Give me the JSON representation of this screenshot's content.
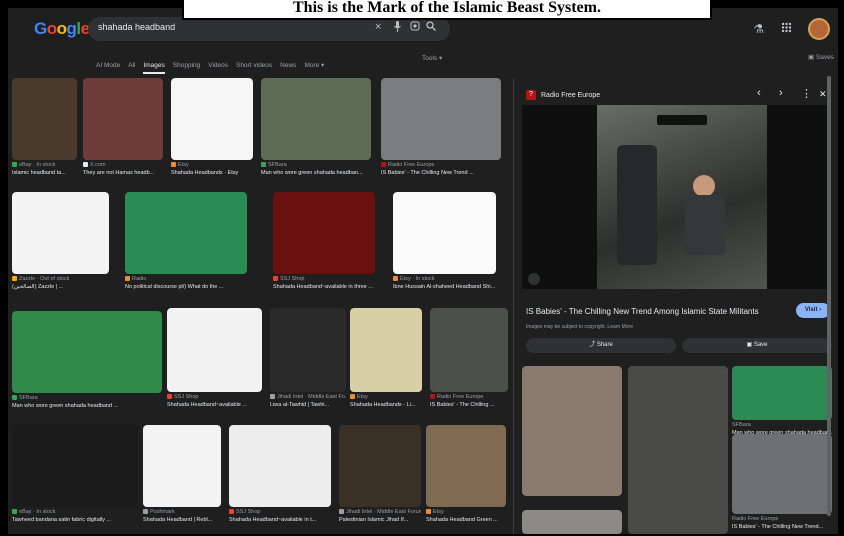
{
  "caption": "This is the Mark of the Islamic Beast System.",
  "header": {
    "logo": [
      "G",
      "o",
      "o",
      "g",
      "l",
      "e"
    ],
    "logo_colors": [
      "#4285f4",
      "#ea4335",
      "#fbbc05",
      "#4285f4",
      "#34a853",
      "#ea4335"
    ],
    "search_value": "shahada headband",
    "icons": {
      "clear": "×",
      "mic": "🎤",
      "lens": "◎",
      "search": "🔍"
    },
    "right": {
      "labs": "⚗",
      "apps": "⋮⋮⋮"
    }
  },
  "tabs": [
    "AI Mode",
    "All",
    "Images",
    "Shopping",
    "Videos",
    "Short videos",
    "News",
    "More ▾"
  ],
  "active_tab": "Images",
  "tools": "Tools ▾",
  "saves": "Saves",
  "results": [
    {
      "src": "eBay · In stock",
      "title": "Islamic headband ta...",
      "color": "#34a853",
      "bg": "#4a3a2c"
    },
    {
      "src": "X.com",
      "title": "They are not Hamas headb...",
      "color": "#e8eaed",
      "bg": "#6e3d3a"
    },
    {
      "src": "Etsy",
      "title": "Shahada Headbands · Etsy",
      "color": "#f28b30",
      "bg": "#f6f6f6"
    },
    {
      "src": "SFBara",
      "title": "Man who wore green shahada headban...",
      "color": "#34a853",
      "bg": "#5c6a56"
    },
    {
      "src": "Radio Free Europe",
      "title": "IS Babies' - The Chilling New Trend ...",
      "color": "#b31515",
      "bg": "#7a7c7e"
    },
    {
      "src": "Zazzle · Out of stock",
      "title": "(الصالحين) Zazzle | ...",
      "color": "#f9ab00",
      "bg": "#f4f4f4"
    },
    {
      "src": "Radio",
      "title": "No political discourse pl/) What do the ...",
      "color": "#f28b30",
      "bg": "#2c8a55"
    },
    {
      "src": "SSJ Shop",
      "title": "Shahada Headband~available in three ...",
      "color": "#ea4335",
      "bg": "#6a1010"
    },
    {
      "src": "Etsy · In stock",
      "title": "Ibne Hussain Al-shaheed Headband Shi...",
      "color": "#f28b30",
      "bg": "#fafafa"
    },
    {
      "src": "SFBara",
      "title": "Man who wore green shahada headband ...",
      "color": "#34a853",
      "bg": "#2f8a4a"
    },
    {
      "src": "SSJ Shop",
      "title": "Shahada Headband~available ...",
      "color": "#ea4335",
      "bg": "#f2f2f2"
    },
    {
      "src": "Jihadi Intel · Middle East Fo...",
      "title": "Liwa al-Tawhid | Tawhi...",
      "color": "#9aa0a6",
      "bg": "#2a2a2a"
    },
    {
      "src": "Etsy",
      "title": "Shahada Headbands - Li...",
      "color": "#f28b30",
      "bg": "#d7cfa5"
    },
    {
      "src": "Radio Free Europe",
      "title": "IS Babies' - The Chilling ...",
      "color": "#b31515",
      "bg": "#4d4f4c"
    },
    {
      "src": "eBay · In stock",
      "title": "Tawheed bandana satin fabric digitally ...",
      "color": "#34a853",
      "bg": "#1b1b1b"
    },
    {
      "src": "Poshmark",
      "title": "Shahada Headband | Rebl...",
      "color": "#9aa0a6",
      "bg": "#f3f3f3"
    },
    {
      "src": "SSJ Shop",
      "title": "Shahada Headband~available in t...",
      "color": "#ea4335",
      "bg": "#ededed"
    },
    {
      "src": "Jihadi Intel · Middle East Forum",
      "title": "Palestinian Islamic Jihad If...",
      "color": "#9aa0a6",
      "bg": "#3a3026"
    },
    {
      "src": "Etsy",
      "title": "Shahada Headband Green ...",
      "color": "#f28b30",
      "bg": "#7f6b52"
    }
  ],
  "panel": {
    "source": "Radio Free Europe",
    "source_initial": "?",
    "controls": {
      "prev": "‹",
      "next": "›",
      "more": "⋮",
      "close": "✕"
    },
    "title": "IS Babies' - The Chilling New Trend Among Islamic State Militants",
    "subtitle": "Images may be subject to copyright. Learn More",
    "visit": "Visit ›",
    "share": "Share",
    "save": "Save",
    "related": [
      {
        "src": "",
        "title": "",
        "bg": "#8a7a70"
      },
      {
        "src": "",
        "title": "",
        "bg": "#4a4a48"
      },
      {
        "src": "SFBara",
        "title": "Man who wore green shahada headban...",
        "bg": "#2c8a55",
        "color": "#34a853"
      },
      {
        "src": "Radio Free Europe",
        "title": "IS Babies' - The Chilling New Trend...",
        "bg": "#6e7074",
        "color": "#b31515"
      },
      {
        "src": "Radio Free Europe",
        "title": "IS Babies' - The Chilling New Trend...",
        "bg": "#8c8a84",
        "color": "#b31515"
      }
    ]
  }
}
